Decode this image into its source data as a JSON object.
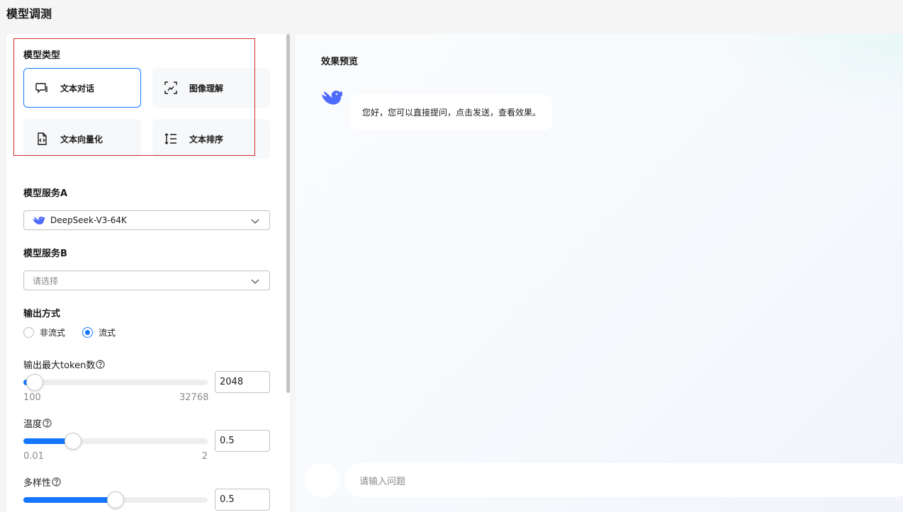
{
  "page": {
    "title": "模型调测"
  },
  "model_type": {
    "label": "模型类型",
    "cards": [
      {
        "label": "文本对话",
        "icon": "chat-icon",
        "active": true
      },
      {
        "label": "图像理解",
        "icon": "image-scan-icon",
        "active": false
      },
      {
        "label": "文本向量化",
        "icon": "file-code-icon",
        "active": false
      },
      {
        "label": "文本排序",
        "icon": "sort-list-icon",
        "active": false
      }
    ]
  },
  "service_a": {
    "label": "模型服务A",
    "value": "DeepSeek-V3-64K",
    "icon": "deepseek-whale-icon"
  },
  "service_b": {
    "label": "模型服务B",
    "placeholder": "请选择"
  },
  "output_mode": {
    "label": "输出方式",
    "options": [
      "非流式",
      "流式"
    ],
    "selected": "流式"
  },
  "max_tokens": {
    "label": "输出最大token数",
    "min": "100",
    "max": "32768",
    "value": "2048",
    "fill_fraction": 0.06
  },
  "temperature": {
    "label": "温度",
    "min": "0.01",
    "max": "2",
    "value": "0.5",
    "fill_fraction": 0.27
  },
  "diversity": {
    "label": "多样性",
    "value": "0.5",
    "fill_fraction": 0.5
  },
  "preview": {
    "title": "效果预览",
    "greeting": "您好，您可以直接提问，点击发送，查看效果。",
    "input_placeholder": "请输入问题"
  },
  "colors": {
    "accent": "#1476ff",
    "highlight_border": "#d42f2f",
    "whale": "#4d6bfe"
  }
}
